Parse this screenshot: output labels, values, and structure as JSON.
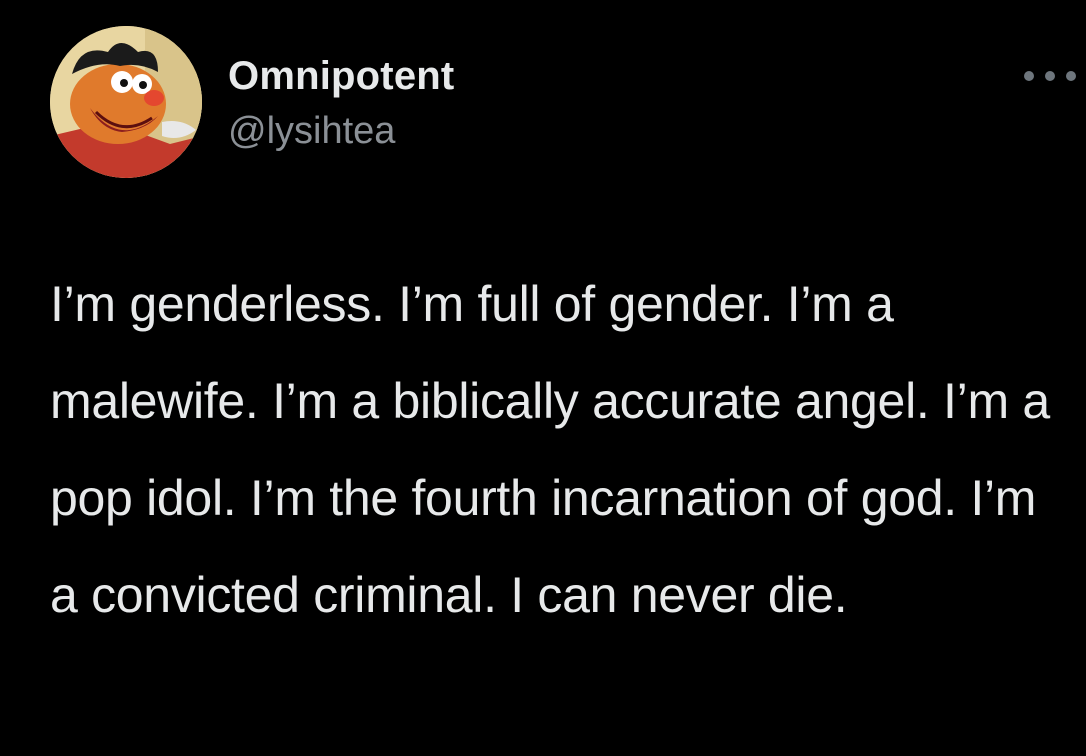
{
  "author": {
    "display_name": "Omnipotent",
    "handle": "@lysihtea",
    "avatar_icon": "avatar-image"
  },
  "menu": {
    "more_icon": "more-options-icon"
  },
  "tweet": {
    "text": "I’m genderless. I’m full of gender. I’m a malewife. I’m a biblically accurate angel. I’m a pop idol. I’m the fourth incarnation of god. I’m a convicted criminal. I can never die."
  },
  "colors": {
    "background": "#000000",
    "primary_text": "#e7e9ea",
    "secondary_text": "#8b9096"
  }
}
